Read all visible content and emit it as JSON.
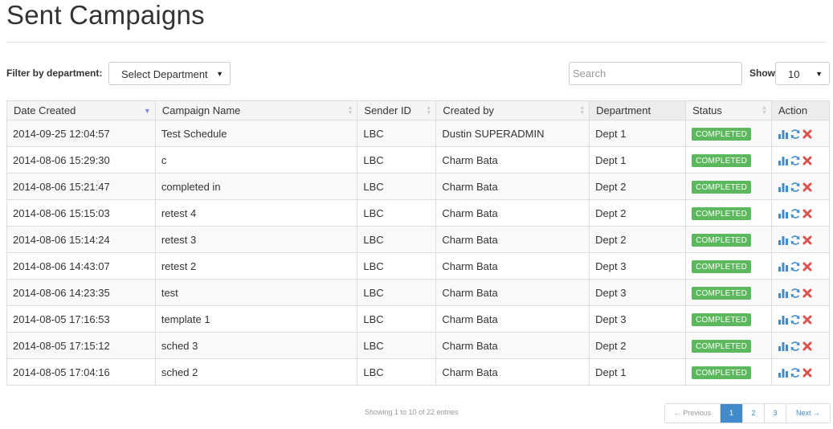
{
  "page": {
    "title": "Sent Campaigns"
  },
  "filters": {
    "department_label": "Filter by department:",
    "department_value": "Select Department",
    "search_placeholder": "Search",
    "show_label": "Show",
    "show_value": "10"
  },
  "table": {
    "columns": [
      "Date Created",
      "Campaign Name",
      "Sender ID",
      "Created by",
      "Department",
      "Status",
      "Action"
    ],
    "rows": [
      {
        "date": "2014-09-25 12:04:57",
        "name": "Test Schedule",
        "sender": "LBC",
        "creator": "Dustin SUPERADMIN",
        "dept": "Dept 1",
        "status": "COMPLETED"
      },
      {
        "date": "2014-08-06 15:29:30",
        "name": "c",
        "sender": "LBC",
        "creator": "Charm Bata",
        "dept": "Dept 1",
        "status": "COMPLETED"
      },
      {
        "date": "2014-08-06 15:21:47",
        "name": "completed in",
        "sender": "LBC",
        "creator": "Charm Bata",
        "dept": "Dept 2",
        "status": "COMPLETED"
      },
      {
        "date": "2014-08-06 15:15:03",
        "name": "retest 4",
        "sender": "LBC",
        "creator": "Charm Bata",
        "dept": "Dept 2",
        "status": "COMPLETED"
      },
      {
        "date": "2014-08-06 15:14:24",
        "name": "retest 3",
        "sender": "LBC",
        "creator": "Charm Bata",
        "dept": "Dept 2",
        "status": "COMPLETED"
      },
      {
        "date": "2014-08-06 14:43:07",
        "name": "retest 2",
        "sender": "LBC",
        "creator": "Charm Bata",
        "dept": "Dept 3",
        "status": "COMPLETED"
      },
      {
        "date": "2014-08-06 14:23:35",
        "name": "test",
        "sender": "LBC",
        "creator": "Charm Bata",
        "dept": "Dept 3",
        "status": "COMPLETED"
      },
      {
        "date": "2014-08-05 17:16:53",
        "name": "template 1",
        "sender": "LBC",
        "creator": "Charm Bata",
        "dept": "Dept 3",
        "status": "COMPLETED"
      },
      {
        "date": "2014-08-05 17:15:12",
        "name": "sched 3",
        "sender": "LBC",
        "creator": "Charm Bata",
        "dept": "Dept 2",
        "status": "COMPLETED"
      },
      {
        "date": "2014-08-05 17:04:16",
        "name": "sched 2",
        "sender": "LBC",
        "creator": "Charm Bata",
        "dept": "Dept 1",
        "status": "COMPLETED"
      }
    ],
    "action_icons": [
      "bar-chart-icon",
      "refresh-icon",
      "delete-icon"
    ]
  },
  "footer": {
    "info": "Showing 1 to 10 of 22 entries",
    "prev": "← Previous",
    "pages": [
      "1",
      "2",
      "3"
    ],
    "next": "Next →"
  },
  "colors": {
    "status_green": "#5cb85c",
    "link_blue": "#428bca",
    "delete_red": "#d9534f",
    "sort_active": "#7f8be8"
  }
}
